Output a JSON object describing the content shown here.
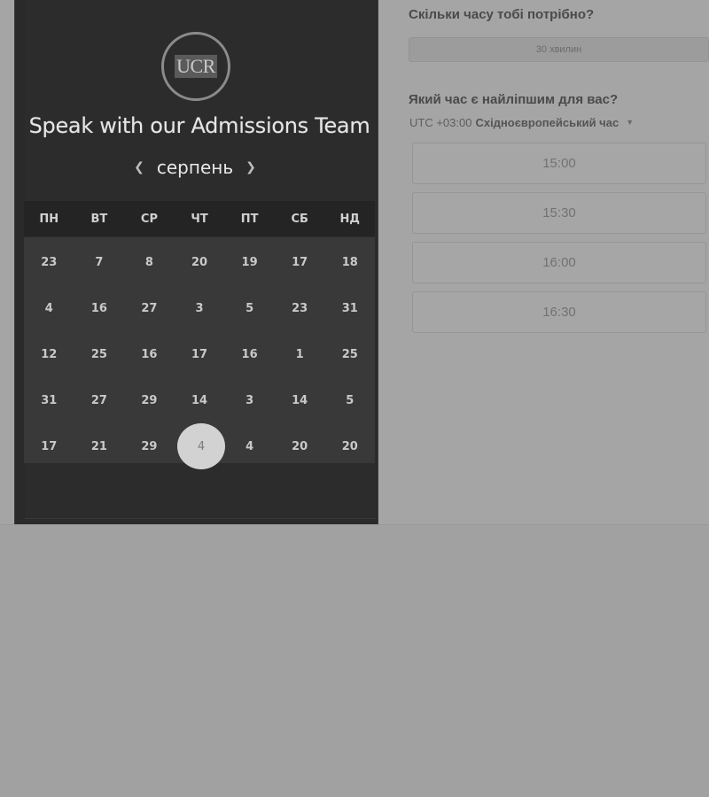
{
  "widget": {
    "logo_text": "UCR",
    "team_title": "Speak with our Admissions Team",
    "month_prev_icon": "chevron-left-icon",
    "month_label": "серпень",
    "month_next_icon": "chevron-right-icon"
  },
  "calendar": {
    "weekdays": [
      "ПН",
      "ВТ",
      "СР",
      "ЧТ",
      "ПТ",
      "СБ",
      "НД"
    ],
    "weeks": [
      [
        "23",
        "7",
        "8",
        "20",
        "19",
        "17",
        "18"
      ],
      [
        "4",
        "16",
        "27",
        "3",
        "5",
        "23",
        "31"
      ],
      [
        "12",
        "25",
        "16",
        "17",
        "16",
        "1",
        "25"
      ],
      [
        "31",
        "27",
        "29",
        "14",
        "3",
        "14",
        "5"
      ],
      [
        "17",
        "21",
        "29",
        "4",
        "4",
        "20",
        "20"
      ]
    ],
    "selected_day": "4"
  },
  "right": {
    "duration_title": "Скільки часу тобі потрібно?",
    "duration_value": "30 хвилин",
    "best_time_title": "Який час є найліпшим для вас?",
    "tz_offset": "UTC +03:00",
    "tz_name": "Східноєвропейський час",
    "tz_caret_icon": "caret-down-icon",
    "slots": [
      "15:00",
      "15:30",
      "16:00",
      "16:30"
    ]
  },
  "colors": {
    "page_background": "#a1a1a1",
    "panel_dark": "#2a2a2a",
    "calendar_grid": "#393939",
    "selected_day": "#d2d2d2"
  }
}
